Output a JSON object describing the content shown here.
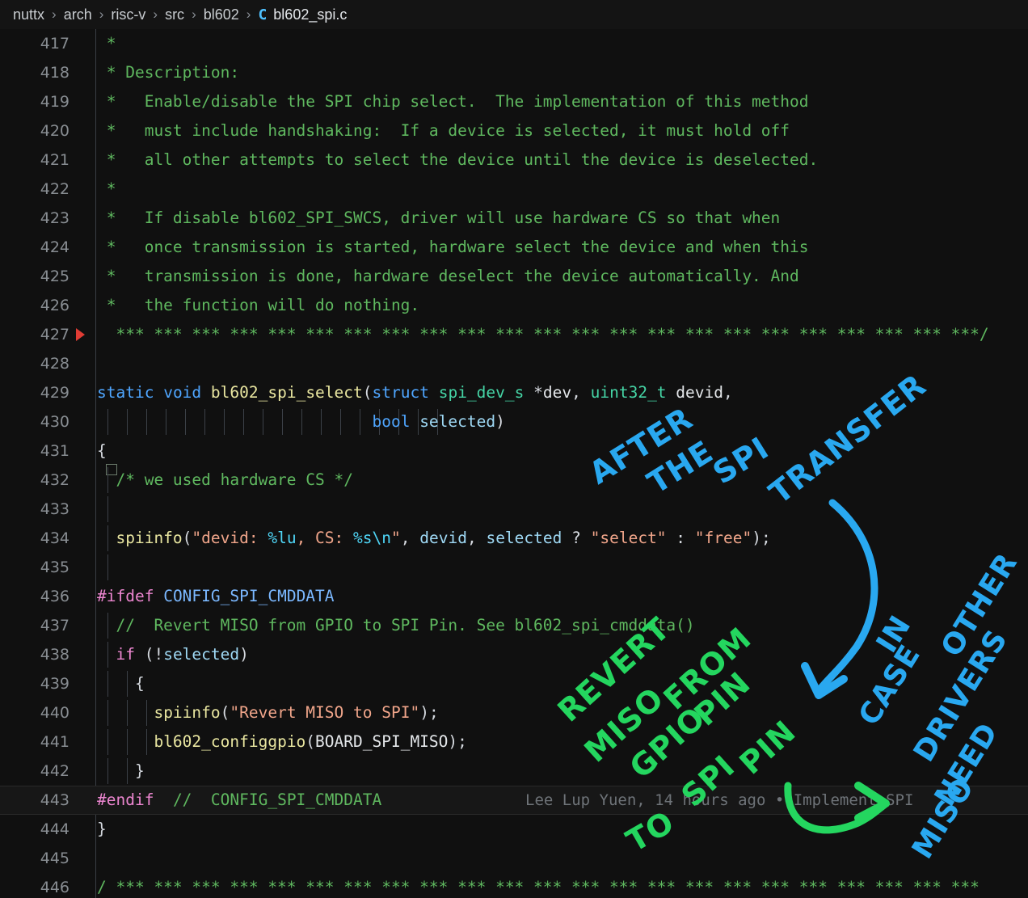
{
  "breadcrumb": {
    "segments": [
      "nuttx",
      "arch",
      "risc-v",
      "src",
      "bl602"
    ],
    "separator": "›",
    "file_icon": "C",
    "file_name": "bl602_spi.c"
  },
  "editor": {
    "language": "c",
    "current_line": 443,
    "first_line": 417,
    "last_line": 446,
    "lines": [
      {
        "n": "417",
        "text": " *"
      },
      {
        "n": "418",
        "text": " * Description:"
      },
      {
        "n": "419",
        "text": " *   Enable/disable the SPI chip select.  The implementation of this method"
      },
      {
        "n": "420",
        "text": " *   must include handshaking:  If a device is selected, it must hold off"
      },
      {
        "n": "421",
        "text": " *   all other attempts to select the device until the device is deselected."
      },
      {
        "n": "422",
        "text": " *"
      },
      {
        "n": "423",
        "text": " *   If disable bl602_SPI_SWCS, driver will use hardware CS so that when"
      },
      {
        "n": "424",
        "text": " *   once transmission is started, hardware select the device and when this"
      },
      {
        "n": "425",
        "text": " *   transmission is done, hardware deselect the device automatically. And"
      },
      {
        "n": "426",
        "text": " *   the function will do nothing."
      },
      {
        "n": "427",
        "text": "  *** *** *** *** *** *** *** *** *** *** *** *** *** *** *** *** *** *** *** *** *** *** ***/"
      },
      {
        "n": "428",
        "text": ""
      },
      {
        "n": "429",
        "text": "static void bl602_spi_select(struct spi_dev_s *dev, uint32_t devid,"
      },
      {
        "n": "430",
        "text": "                             bool selected)"
      },
      {
        "n": "431",
        "text": "{"
      },
      {
        "n": "432",
        "text": "  /* we used hardware CS */"
      },
      {
        "n": "433",
        "text": ""
      },
      {
        "n": "434",
        "text": "  spiinfo(\"devid: %lu, CS: %s\\n\", devid, selected ? \"select\" : \"free\");"
      },
      {
        "n": "435",
        "text": ""
      },
      {
        "n": "436",
        "text": "#ifdef CONFIG_SPI_CMDDATA"
      },
      {
        "n": "437",
        "text": "  //  Revert MISO from GPIO to SPI Pin. See bl602_spi_cmddata()"
      },
      {
        "n": "438",
        "text": "  if (!selected)"
      },
      {
        "n": "439",
        "text": "    {"
      },
      {
        "n": "440",
        "text": "      spiinfo(\"Revert MISO to SPI\");"
      },
      {
        "n": "441",
        "text": "      bl602_configgpio(BOARD_SPI_MISO);"
      },
      {
        "n": "442",
        "text": "    }"
      },
      {
        "n": "443",
        "text": "#endif  //  CONFIG_SPI_CMDDATA"
      },
      {
        "n": "444",
        "text": "}"
      },
      {
        "n": "445",
        "text": ""
      },
      {
        "n": "446",
        "text": "/ *** *** *** *** *** *** *** *** *** *** *** *** *** *** *** *** *** *** *** *** *** *** ***"
      }
    ],
    "blame": "Lee Lup Yuen, 14 hours ago • Implement SPI",
    "gutter_marker": "debug-step-arrow"
  },
  "annotations": {
    "blue_top": "AFTER THE SPI TRANSFER",
    "blue_right": "IN CASE OTHER DRIVERS NEED MISO",
    "green_left": "REVERT MISO FROM GPIO PIN TO SPI PIN",
    "blue_color": "#29a8f0",
    "green_color": "#24d65f"
  },
  "colors": {
    "background": "#101010",
    "breadcrumb_bg": "#141414",
    "current_line_bg": "#171717",
    "comment": "#5fb85f",
    "keyword": "#4fa6ff",
    "preprocessor": "#ec86d0",
    "function": "#e9e6a0",
    "type": "#45d4a5",
    "string": "#f0a58a",
    "escape": "#4fd6f7",
    "variable": "#9fd9f5",
    "linenumber": "#888d92",
    "blame_text": "#6e7378",
    "debug_marker": "#e03c34"
  }
}
